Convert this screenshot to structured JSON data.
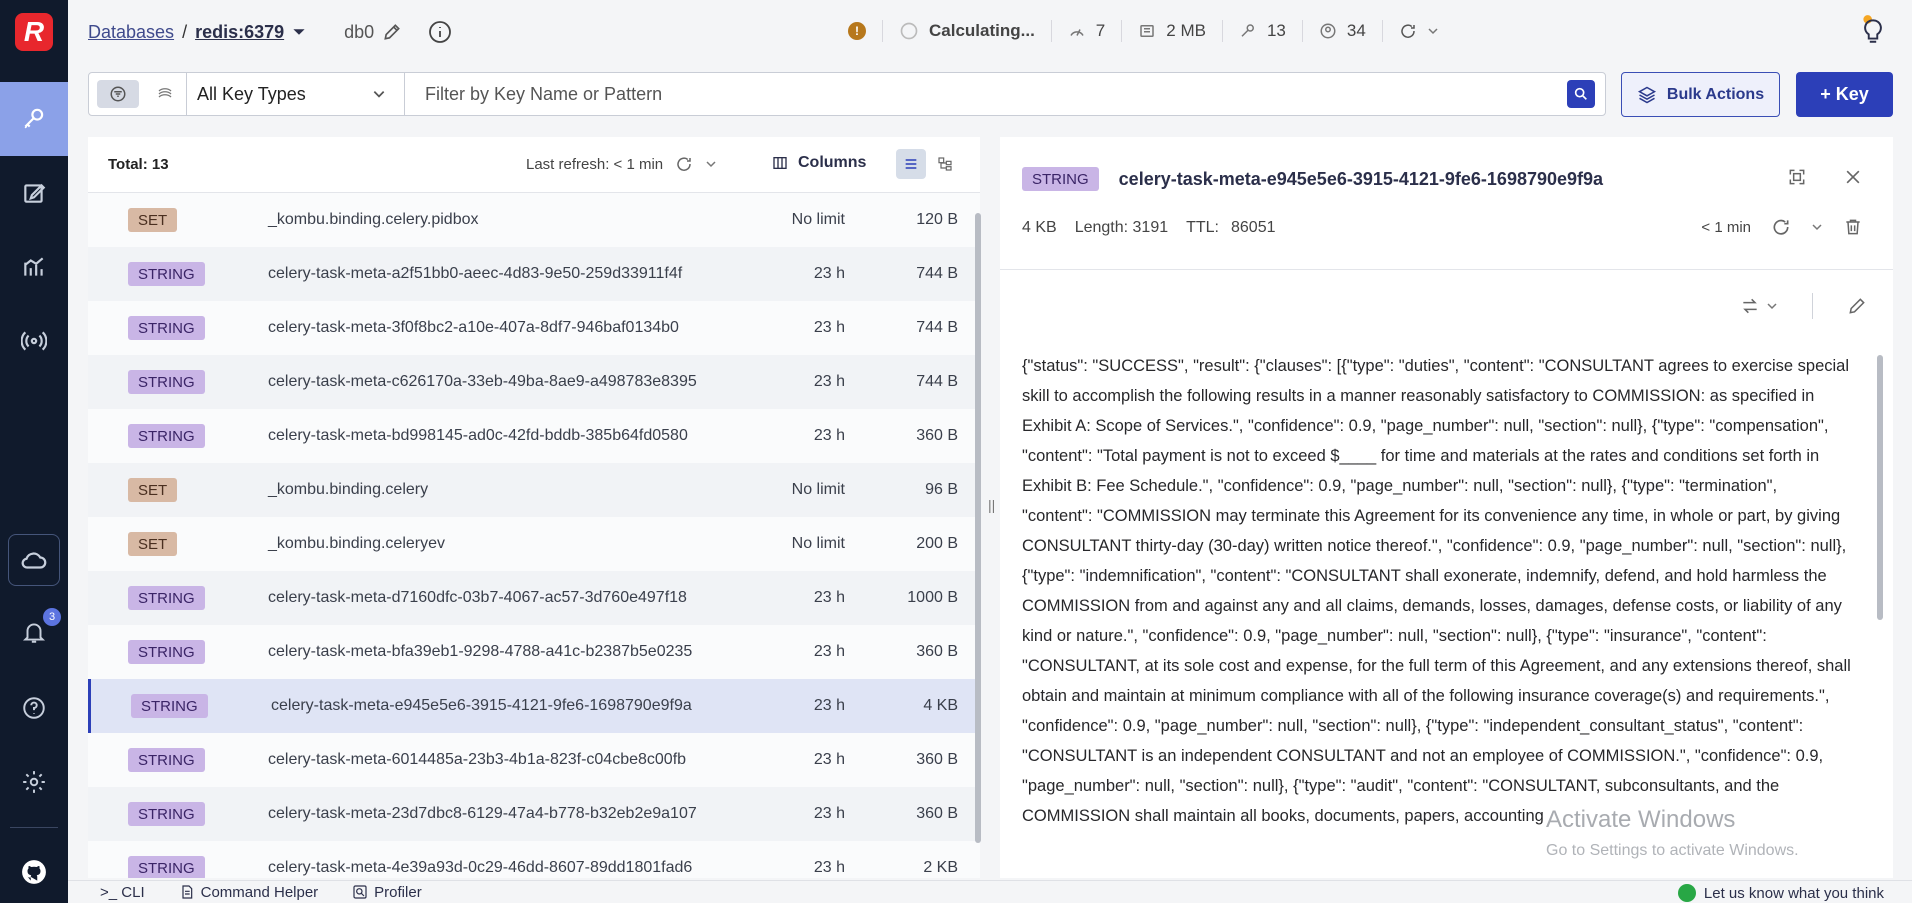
{
  "header": {
    "databases_link": "Databases",
    "separator": "/",
    "db_name": "redis:6379",
    "db_index": "db0",
    "calculating": "Calculating...",
    "ops": "7",
    "memory": "2 MB",
    "keys": "13",
    "clients": "34",
    "warning_glyph": "!"
  },
  "filter": {
    "key_type": "All Key Types",
    "search_placeholder": "Filter by Key Name or Pattern",
    "bulk_actions": "Bulk Actions",
    "add_key": "+ Key"
  },
  "list": {
    "total": "Total: 13",
    "last_refresh": "Last refresh: < 1 min",
    "columns": "Columns",
    "rows": [
      {
        "type": "SET",
        "name": "_kombu.binding.celery.pidbox",
        "ttl": "No limit",
        "size": "120 B"
      },
      {
        "type": "STRING",
        "name": "celery-task-meta-a2f51bb0-aeec-4d83-9e50-259d33911f4f",
        "ttl": "23 h",
        "size": "744 B"
      },
      {
        "type": "STRING",
        "name": "celery-task-meta-3f0f8bc2-a10e-407a-8df7-946baf0134b0",
        "ttl": "23 h",
        "size": "744 B"
      },
      {
        "type": "STRING",
        "name": "celery-task-meta-c626170a-33eb-49ba-8ae9-a498783e8395",
        "ttl": "23 h",
        "size": "744 B"
      },
      {
        "type": "STRING",
        "name": "celery-task-meta-bd998145-ad0c-42fd-bddb-385b64fd0580",
        "ttl": "23 h",
        "size": "360 B"
      },
      {
        "type": "SET",
        "name": "_kombu.binding.celery",
        "ttl": "No limit",
        "size": "96 B"
      },
      {
        "type": "SET",
        "name": "_kombu.binding.celeryev",
        "ttl": "No limit",
        "size": "200 B"
      },
      {
        "type": "STRING",
        "name": "celery-task-meta-d7160dfc-03b7-4067-ac57-3d760e497f18",
        "ttl": "23 h",
        "size": "1000 B"
      },
      {
        "type": "STRING",
        "name": "celery-task-meta-bfa39eb1-9298-4788-a41c-b2387b5e0235",
        "ttl": "23 h",
        "size": "360 B"
      },
      {
        "type": "STRING",
        "name": "celery-task-meta-e945e5e6-3915-4121-9fe6-1698790e9f9a",
        "ttl": "23 h",
        "size": "4 KB",
        "selected": true
      },
      {
        "type": "STRING",
        "name": "celery-task-meta-6014485a-23b3-4b1a-823f-c04cbe8c00fb",
        "ttl": "23 h",
        "size": "360 B"
      },
      {
        "type": "STRING",
        "name": "celery-task-meta-23d7dbc8-6129-47a4-b778-b32eb2e9a107",
        "ttl": "23 h",
        "size": "360 B"
      },
      {
        "type": "STRING",
        "name": "celery-task-meta-4e39a93d-0c29-46dd-8607-89dd1801fad6",
        "ttl": "23 h",
        "size": "2 KB"
      }
    ]
  },
  "detail": {
    "type": "STRING",
    "key": "celery-task-meta-e945e5e6-3915-4121-9fe6-1698790e9f9a",
    "size": "4 KB",
    "length": "Length: 3191",
    "ttl_label": "TTL:",
    "ttl_value": "86051",
    "refreshed": "< 1 min",
    "value": "{\"status\": \"SUCCESS\", \"result\": {\"clauses\": [{\"type\": \"duties\", \"content\": \"CONSULTANT agrees to exercise special skill to accomplish the following results in a manner reasonably satisfactory to COMMISSION: as specified in Exhibit A: Scope of Services.\", \"confidence\": 0.9, \"page_number\": null, \"section\": null}, {\"type\": \"compensation\", \"content\": \"Total payment is not to exceed $____ for time and materials at the rates and conditions set forth in Exhibit B: Fee Schedule.\", \"confidence\": 0.9, \"page_number\": null, \"section\": null}, {\"type\": \"termination\", \"content\": \"COMMISSION may terminate this Agreement for its convenience any time, in whole or part, by giving CONSULTANT thirty-day (30-day) written notice thereof.\", \"confidence\": 0.9, \"page_number\": null, \"section\": null}, {\"type\": \"indemnification\", \"content\": \"CONSULTANT shall exonerate, indemnify, defend, and hold harmless the COMMISSION from and against any and all claims, demands, losses, damages, defense costs, or liability of any kind or nature.\", \"confidence\": 0.9, \"page_number\": null, \"section\": null}, {\"type\": \"insurance\", \"content\": \"CONSULTANT, at its sole cost and expense, for the full term of this Agreement, and any extensions thereof, shall obtain and maintain at minimum compliance with all of the following insurance coverage(s) and requirements.\", \"confidence\": 0.9, \"page_number\": null, \"section\": null}, {\"type\": \"independent_consultant_status\", \"content\": \"CONSULTANT is an independent CONSULTANT and not an employee of COMMISSION.\", \"confidence\": 0.9, \"page_number\": null, \"section\": null}, {\"type\": \"audit\", \"content\": \"CONSULTANT, subconsultants, and the COMMISSION shall maintain all books, documents, papers, accounting"
  },
  "notifications_count": "3",
  "watermark": {
    "title": "Activate Windows",
    "subtitle": "Go to Settings to activate Windows."
  },
  "bottom": {
    "cli": ">_ CLI",
    "command_helper": "Command Helper",
    "profiler": "Profiler",
    "feedback": "Let us know what you think"
  },
  "colors": {
    "accent": "#2c3fb8",
    "sidebar": "#101a2c",
    "set_tag": "#d8b9a4",
    "string_tag": "#c9b5e6"
  }
}
